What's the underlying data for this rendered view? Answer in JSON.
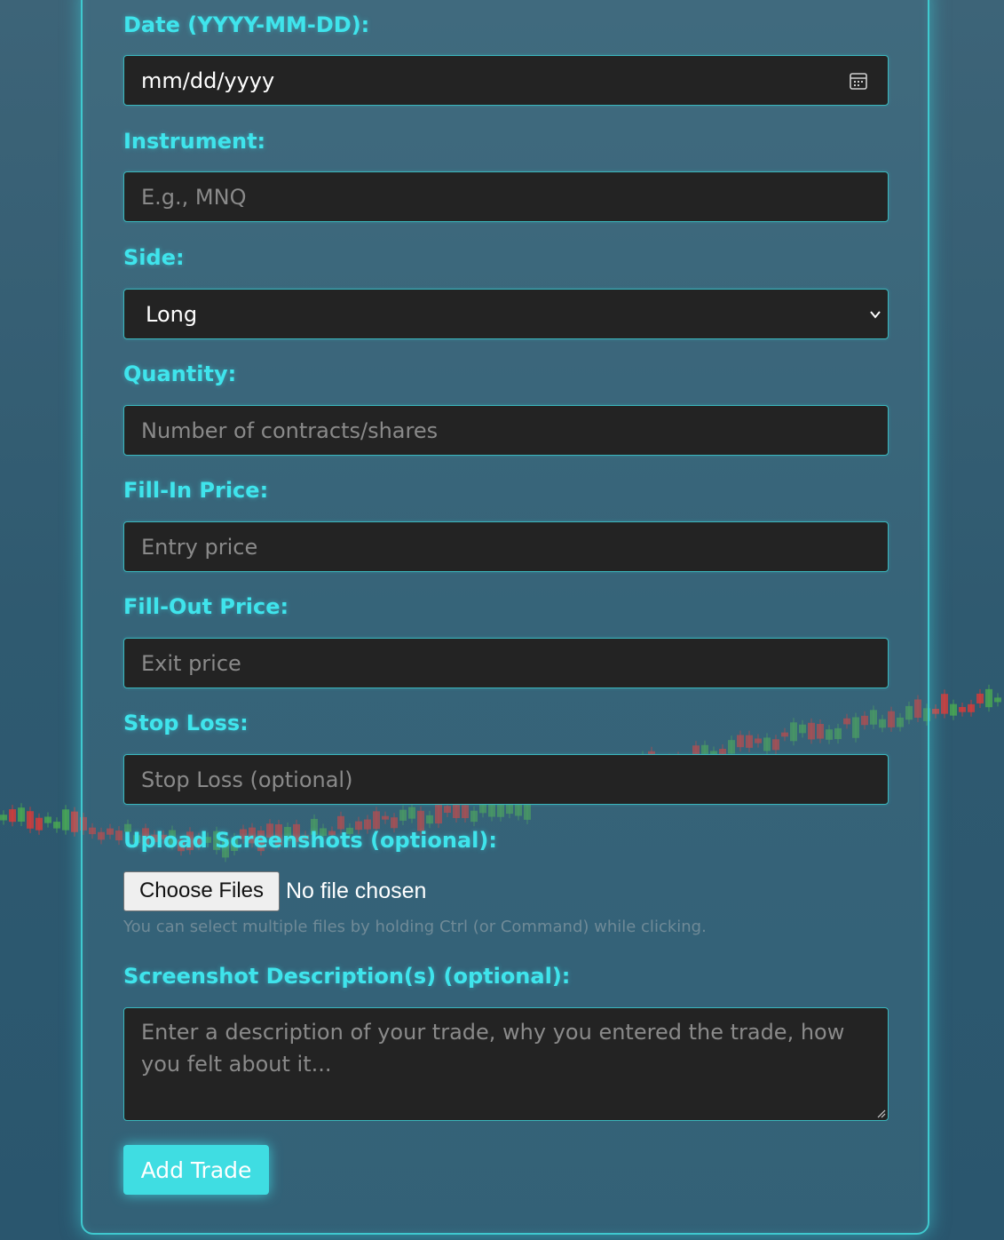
{
  "colors": {
    "accent": "#3fe4ec",
    "field_bg": "#232323",
    "candle_up": "#4caf50",
    "candle_down": "#e53935"
  },
  "form": {
    "date": {
      "label": "Date (YYYY-MM-DD):",
      "value": "mm/dd/yyyy",
      "icon": "calendar-icon"
    },
    "instrument": {
      "label": "Instrument:",
      "placeholder": "E.g., MNQ"
    },
    "side": {
      "label": "Side:",
      "value": "Long",
      "icon": "chevron-down-icon"
    },
    "quantity": {
      "label": "Quantity:",
      "placeholder": "Number of contracts/shares"
    },
    "fill_in": {
      "label": "Fill-In Price:",
      "placeholder": "Entry price"
    },
    "fill_out": {
      "label": "Fill-Out Price:",
      "placeholder": "Exit price"
    },
    "stop_loss": {
      "label": "Stop Loss:",
      "placeholder": "Stop Loss (optional)"
    },
    "upload": {
      "label": "Upload Screenshots (optional):",
      "button": "Choose Files",
      "status": "No file chosen",
      "hint": "You can select multiple files by holding Ctrl (or Command) while clicking."
    },
    "description": {
      "label": "Screenshot Description(s) (optional):",
      "placeholder": "Enter a description of your trade, why you entered the trade, how you felt about it..."
    },
    "submit": "Add Trade"
  }
}
